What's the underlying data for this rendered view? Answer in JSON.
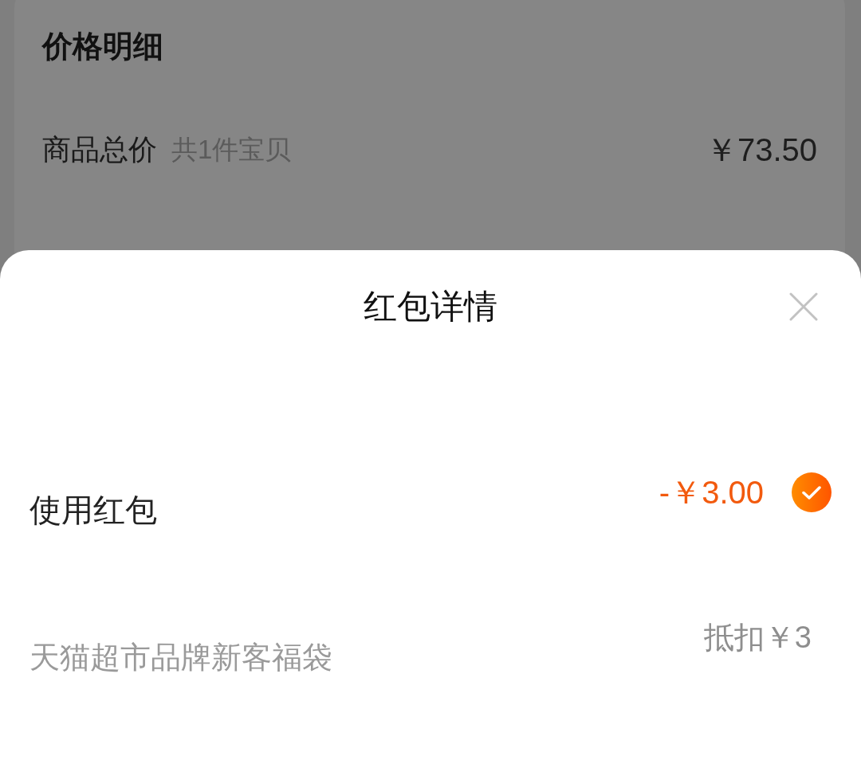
{
  "price_detail": {
    "title": "价格明细",
    "rows": [
      {
        "label": "商品总价",
        "note": "共1件宝贝",
        "value": "￥73.50"
      }
    ]
  },
  "sheet": {
    "title": "红包详情",
    "use_packet": {
      "label": "使用红包",
      "amount": "-￥3.00",
      "checked": true
    },
    "packets": [
      {
        "name": "天猫超市品牌新客福袋",
        "discount": "抵扣￥3"
      }
    ]
  }
}
